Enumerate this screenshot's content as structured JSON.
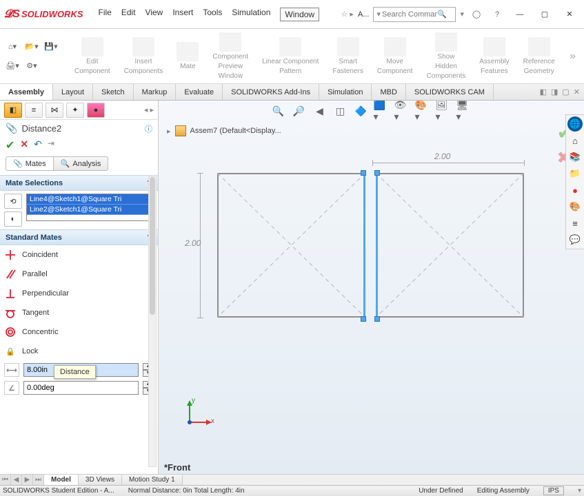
{
  "app": {
    "name": "SOLIDWORKS",
    "menu": [
      "File",
      "Edit",
      "View",
      "Insert",
      "Tools",
      "Simulation",
      "Window"
    ],
    "active_menu": "Window",
    "star_label": "A...",
    "search_placeholder": "Search Comman"
  },
  "ribbon": {
    "groups": [
      {
        "label1": "Edit",
        "label2": "Component"
      },
      {
        "label1": "Insert",
        "label2": "Components"
      },
      {
        "label1": "Mate",
        "label2": ""
      },
      {
        "label1": "Component",
        "label2": "Preview",
        "label3": "Window"
      },
      {
        "label1": "Linear Component",
        "label2": "Pattern"
      },
      {
        "label1": "Smart",
        "label2": "Fasteners"
      },
      {
        "label1": "Move",
        "label2": "Component"
      },
      {
        "label1": "Show",
        "label2": "Hidden",
        "label3": "Components"
      },
      {
        "label1": "Assembly",
        "label2": "Features"
      },
      {
        "label1": "Reference",
        "label2": "Geometry"
      }
    ]
  },
  "tabs": [
    "Assembly",
    "Layout",
    "Sketch",
    "Markup",
    "Evaluate",
    "SOLIDWORKS Add-Ins",
    "Simulation",
    "MBD",
    "SOLIDWORKS CAM"
  ],
  "active_tab": "Assembly",
  "prop": {
    "title": "Distance2",
    "sub_tabs": {
      "mates": "Mates",
      "analysis": "Analysis"
    },
    "mate_selections_label": "Mate Selections",
    "selections": [
      "Line4@Sketch1@Square Tri",
      "Line2@Sketch1@Square Tri"
    ],
    "standard_mates_label": "Standard Mates",
    "mates": [
      "Coincident",
      "Parallel",
      "Perpendicular",
      "Tangent",
      "Concentric",
      "Lock"
    ],
    "tooltip": "Distance",
    "distance_value": "8.00in",
    "angle_value": "0.00deg"
  },
  "viewport": {
    "crumb": "Assem7  (Default<Display...",
    "dim_h": "2.00",
    "dim_v": "2.00",
    "view": "*Front",
    "axes": {
      "x": "x",
      "y": "y"
    }
  },
  "bottom_tabs": [
    "Model",
    "3D Views",
    "Motion Study 1"
  ],
  "status": {
    "edition": "SOLIDWORKS Student Edition - A...",
    "distance": "Normal Distance: 0in Total Length: 4in",
    "defined": "Under Defined",
    "mode": "Editing Assembly",
    "units": "IPS"
  }
}
